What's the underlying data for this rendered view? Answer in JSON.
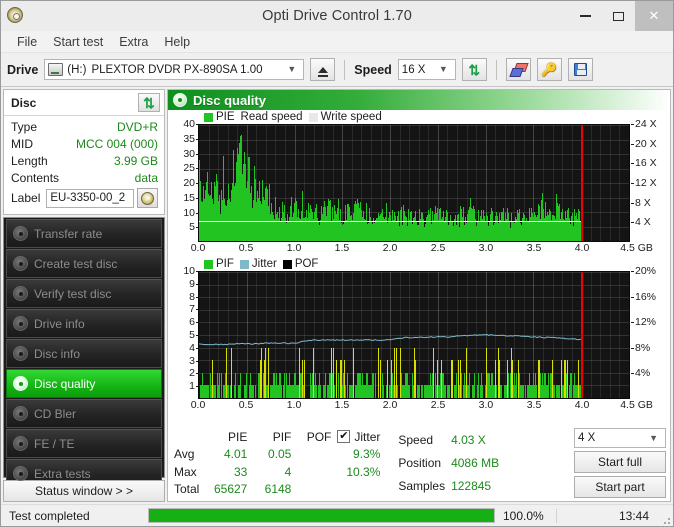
{
  "window": {
    "title": "Opti Drive Control 1.70",
    "icon": "disc-icon",
    "minimize": "–",
    "maximize": "□",
    "close": "✕"
  },
  "menu": {
    "items": [
      "File",
      "Start test",
      "Extra",
      "Help"
    ]
  },
  "toolbar": {
    "drive_label": "Drive",
    "drive_letter": "(H:)",
    "drive_value": "PLEXTOR DVDR  PX-890SA 1.00",
    "eject_title": "Eject",
    "speed_label": "Speed",
    "speed_value": "16 X",
    "refresh_title": "Refresh",
    "erase_title": "Erase",
    "key_title": "Key",
    "save_title": "Save"
  },
  "disc_panel": {
    "title": "Disc",
    "refresh_title": "Refresh disc",
    "rows": [
      {
        "key": "Type",
        "value": "DVD+R"
      },
      {
        "key": "MID",
        "value": "MCC 004 (000)"
      },
      {
        "key": "Length",
        "value": "3.99 GB"
      },
      {
        "key": "Contents",
        "value": "data"
      }
    ],
    "label_key": "Label",
    "label_value": "EU-3350-00_2",
    "label_button_title": "Disc label"
  },
  "sidebar": {
    "items": [
      {
        "label": "Transfer rate",
        "active": false
      },
      {
        "label": "Create test disc",
        "active": false
      },
      {
        "label": "Verify test disc",
        "active": false
      },
      {
        "label": "Drive info",
        "active": false
      },
      {
        "label": "Disc info",
        "active": false
      },
      {
        "label": "Disc quality",
        "active": true
      },
      {
        "label": "CD Bler",
        "active": false
      },
      {
        "label": "FE / TE",
        "active": false
      },
      {
        "label": "Extra tests",
        "active": false
      }
    ],
    "status_window_button": "Status window > >"
  },
  "panel": {
    "title": "Disc quality",
    "icon": "disc-quality-icon"
  },
  "colors": {
    "pie": "#22c422",
    "pif": "#22c422",
    "pif_high": "#d8e000",
    "pof": "#000000",
    "jitter": "#7fb8c8",
    "read_speed": "#ffffff",
    "write_speed": "#e8e8e8",
    "marker": "#ee0000",
    "accent_green": "#14b414",
    "value_green": "#1c8a1c",
    "plot_bg": "#141414"
  },
  "chart_data": [
    {
      "type": "area",
      "name": "pie-chart",
      "title": "PIE",
      "legend": [
        {
          "label": "PIE",
          "color": "#22c422",
          "swatch": true
        },
        {
          "label": "Read speed",
          "color": "#ffffff",
          "swatch": false
        },
        {
          "label": "Write speed",
          "color": "#e8e8e8",
          "swatch": true
        }
      ],
      "xlabel": "GB",
      "xlim": [
        0,
        4.5
      ],
      "xticks": [
        0.0,
        0.5,
        1.0,
        1.5,
        2.0,
        2.5,
        3.0,
        3.5,
        4.0,
        4.5
      ],
      "xticklabels": [
        "0.0",
        "0.5",
        "1.0",
        "1.5",
        "2.0",
        "2.5",
        "3.0",
        "3.5",
        "4.0",
        "4.5"
      ],
      "ylim": [
        0,
        40
      ],
      "yticks": [
        5,
        10,
        15,
        20,
        25,
        30,
        35,
        40
      ],
      "yticklabels": [
        "5",
        "10",
        "15",
        "20",
        "25",
        "30",
        "35",
        "40"
      ],
      "y2lim": [
        0,
        24
      ],
      "y2ticks": [
        4,
        8,
        12,
        16,
        20,
        24
      ],
      "y2ticklabels": [
        "4 X",
        "8 X",
        "12 X",
        "16 X",
        "20 X",
        "24 X"
      ],
      "grid": true,
      "data_end_x": 4.0,
      "read_speed_value": 4.03,
      "series": [
        {
          "name": "PIE",
          "color": "#22c422",
          "x": [
            0.0,
            0.02,
            0.04,
            0.06,
            0.08,
            0.1,
            0.12,
            0.14,
            0.16,
            0.18,
            0.2,
            0.22,
            0.24,
            0.26,
            0.28,
            0.3,
            0.32,
            0.34,
            0.36,
            0.38,
            0.4,
            0.42,
            0.44,
            0.46,
            0.48,
            0.5,
            0.52,
            0.54,
            0.56,
            0.58,
            0.6,
            0.62,
            0.64,
            0.66,
            0.68,
            0.7,
            0.72,
            0.74,
            0.76,
            0.78,
            0.8,
            0.82,
            0.84,
            0.86,
            0.88,
            0.9,
            0.92,
            0.94,
            0.96,
            0.98,
            1.0,
            1.05,
            1.1,
            1.15,
            1.2,
            1.25,
            1.3,
            1.35,
            1.4,
            1.45,
            1.5,
            1.55,
            1.6,
            1.65,
            1.7,
            1.75,
            1.8,
            1.85,
            1.9,
            1.95,
            2.0,
            2.05,
            2.1,
            2.15,
            2.2,
            2.25,
            2.3,
            2.35,
            2.4,
            2.45,
            2.5,
            2.55,
            2.6,
            2.65,
            2.7,
            2.75,
            2.8,
            2.85,
            2.9,
            2.95,
            3.0,
            3.05,
            3.1,
            3.15,
            3.2,
            3.25,
            3.3,
            3.35,
            3.4,
            3.45,
            3.5,
            3.55,
            3.6,
            3.65,
            3.7,
            3.75,
            3.8,
            3.85,
            3.9,
            3.95,
            4.0
          ],
          "values": [
            25,
            18,
            22,
            16,
            24,
            17,
            21,
            15,
            20,
            23,
            18,
            16,
            22,
            19,
            17,
            15,
            20,
            24,
            27,
            29,
            33,
            30,
            26,
            28,
            24,
            22,
            25,
            21,
            19,
            23,
            20,
            18,
            16,
            15,
            17,
            14,
            13,
            15,
            12,
            14,
            11,
            13,
            10,
            12,
            11,
            9,
            13,
            10,
            12,
            9,
            14,
            11,
            13,
            10,
            12,
            9,
            11,
            13,
            10,
            12,
            9,
            11,
            10,
            12,
            9,
            11,
            8,
            10,
            9,
            11,
            8,
            10,
            9,
            11,
            8,
            10,
            9,
            8,
            10,
            9,
            11,
            8,
            10,
            9,
            8,
            10,
            9,
            11,
            8,
            10,
            9,
            8,
            10,
            9,
            11,
            8,
            10,
            9,
            8,
            10,
            9,
            11,
            14,
            9,
            10,
            17,
            9,
            11,
            8,
            10,
            9
          ]
        }
      ],
      "stats": {
        "avg": 4.01,
        "max": 33,
        "total": 65627
      }
    },
    {
      "type": "bar",
      "name": "pif-chart",
      "title": "PIF",
      "legend": [
        {
          "label": "PIF",
          "color": "#22c422",
          "swatch": true
        },
        {
          "label": "Jitter",
          "color": "#7fb8c8",
          "swatch": true
        },
        {
          "label": "POF",
          "color": "#000000",
          "swatch": true
        }
      ],
      "xlabel": "GB",
      "xlim": [
        0,
        4.5
      ],
      "xticks": [
        0.0,
        0.5,
        1.0,
        1.5,
        2.0,
        2.5,
        3.0,
        3.5,
        4.0,
        4.5
      ],
      "xticklabels": [
        "0.0",
        "0.5",
        "1.0",
        "1.5",
        "2.0",
        "2.5",
        "3.0",
        "3.5",
        "4.0",
        "4.5"
      ],
      "ylim": [
        0,
        10
      ],
      "yticks": [
        1,
        2,
        3,
        4,
        5,
        6,
        7,
        8,
        9,
        10
      ],
      "yticklabels": [
        "1",
        "2",
        "3",
        "4",
        "5",
        "6",
        "7",
        "8",
        "9",
        "10"
      ],
      "y2lim": [
        0,
        20
      ],
      "y2ticks": [
        4,
        8,
        12,
        16,
        20
      ],
      "y2ticklabels": [
        "4%",
        "8%",
        "12%",
        "16%",
        "20%"
      ],
      "grid": true,
      "data_end_x": 4.0,
      "series": [
        {
          "name": "Jitter",
          "color": "#7fb8c8",
          "unit": "%",
          "x": [
            0.0,
            0.1,
            0.2,
            0.3,
            0.4,
            0.5,
            0.6,
            0.7,
            0.8,
            0.9,
            1.0,
            1.1,
            1.2,
            1.3,
            1.4,
            1.5,
            1.6,
            1.7,
            1.8,
            1.9,
            2.0,
            2.1,
            2.2,
            2.3,
            2.4,
            2.5,
            2.6,
            2.7,
            2.8,
            2.9,
            3.0,
            3.1,
            3.2,
            3.3,
            3.4,
            3.5,
            3.6,
            3.7,
            3.8,
            3.9,
            4.0
          ],
          "values": [
            8.6,
            8.5,
            8.5,
            8.5,
            8.6,
            8.6,
            8.6,
            8.7,
            8.7,
            8.7,
            8.7,
            9.0,
            9.2,
            9.2,
            9.2,
            9.2,
            9.2,
            9.2,
            9.2,
            9.2,
            9.3,
            9.5,
            9.6,
            9.6,
            9.7,
            9.7,
            9.7,
            9.8,
            9.9,
            10.0,
            10.0,
            10.0,
            9.9,
            9.9,
            9.8,
            9.7,
            9.6,
            9.6,
            9.5,
            9.4,
            9.3
          ]
        }
      ],
      "stats": {
        "avg": 0.05,
        "max": 4,
        "total": 6148,
        "jitter_avg": "9.3%",
        "jitter_max": "10.3%"
      }
    }
  ],
  "stats": {
    "columns": [
      "PIE",
      "PIF",
      "POF",
      "Jitter"
    ],
    "jitter_checked": true,
    "jitter_check_glyph": "✔",
    "rows": [
      {
        "label": "Avg",
        "pie": "4.01",
        "pif": "0.05",
        "pof": "",
        "jitter": "9.3%"
      },
      {
        "label": "Max",
        "pie": "33",
        "pif": "4",
        "pof": "",
        "jitter": "10.3%"
      },
      {
        "label": "Total",
        "pie": "65627",
        "pif": "6148",
        "pof": "",
        "jitter": ""
      }
    ],
    "info": [
      {
        "key": "Speed",
        "value": "4.03 X"
      },
      {
        "key": "Position",
        "value": "4086 MB"
      },
      {
        "key": "Samples",
        "value": "122845"
      }
    ]
  },
  "actions": {
    "test_speed_value": "4 X",
    "start_full": "Start full",
    "start_part": "Start part"
  },
  "statusbar": {
    "text": "Test completed",
    "percent_label": "100.0%",
    "percent_value": 100,
    "time": "13:44"
  }
}
